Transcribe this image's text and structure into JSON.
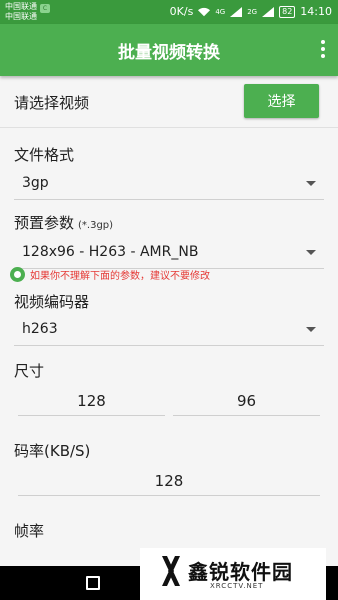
{
  "status": {
    "carrier1": "中国联通",
    "carrier2": "中国联通",
    "speed": "0K/s",
    "net1": "4G",
    "net2": "2G",
    "battery": "82",
    "time": "14:10"
  },
  "toolbar": {
    "title": "批量视频转换",
    "menu_icon": "more-vert-icon"
  },
  "select_video": {
    "label": "请选择视频",
    "button": "选择"
  },
  "format": {
    "label": "文件格式",
    "value": "3gp"
  },
  "preset": {
    "label": "预置参数",
    "hint": "(*.3gp)",
    "value": "128x96 - H263 - AMR_NB"
  },
  "warning": "如果你不理解下面的参数，建议不要修改",
  "encoder": {
    "label": "视频编码器",
    "value": "h263"
  },
  "size": {
    "label": "尺寸",
    "width": "128",
    "height": "96"
  },
  "bitrate": {
    "label": "码率(KB/S)",
    "value": "128"
  },
  "framerate": {
    "label": "帧率"
  },
  "watermark": {
    "text": "鑫锐软件园",
    "sub": "XRCCTV.NET"
  },
  "colors": {
    "primary": "#4caf50",
    "statusbar": "#3a9a3d",
    "warning": "#e53935"
  }
}
